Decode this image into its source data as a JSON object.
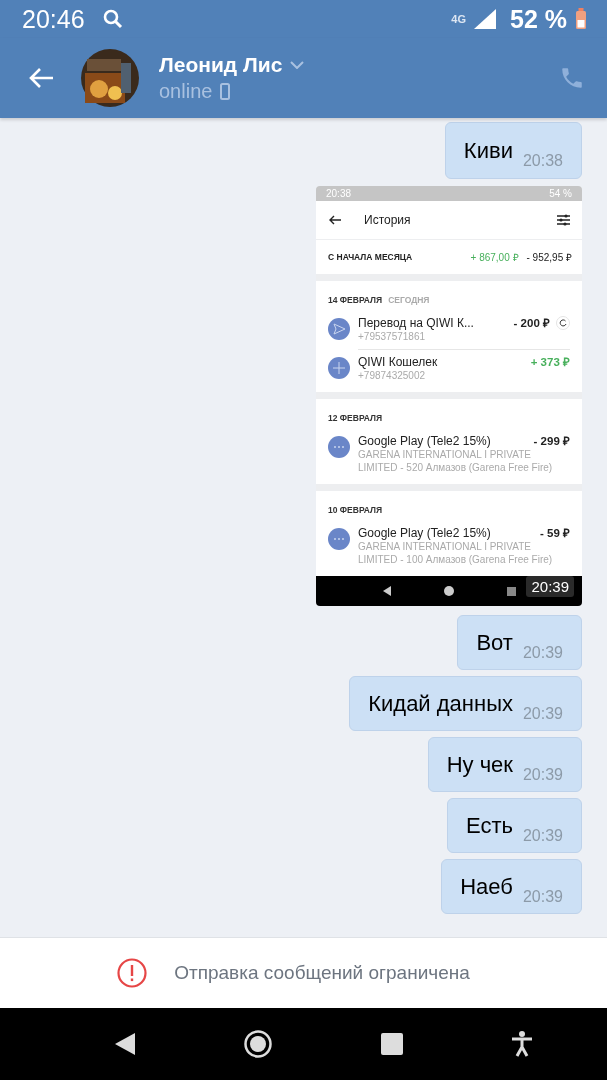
{
  "status_bar": {
    "time": "20:46",
    "network": "4G",
    "battery": "52 %"
  },
  "header": {
    "name": "Леонид Лис",
    "status": "online"
  },
  "messages": [
    {
      "kind": "text",
      "text": "Киви",
      "time": "20:38"
    },
    {
      "kind": "screenshot",
      "time": "20:39",
      "shot": {
        "status_time": "20:38",
        "battery": "54 %",
        "title": "История",
        "summary": {
          "label": "С НАЧАЛА МЕСЯЦА",
          "income": "+ 867,00 ₽",
          "expense": "- 952,95 ₽"
        },
        "groups": [
          {
            "date": "14 ФЕВРАЛЯ",
            "note": "СЕГОДНЯ",
            "items": [
              {
                "kind": "transfer",
                "title": "Перевод на QIWI К...",
                "sub": "+79537571861",
                "amount": "- 200 ₽",
                "positive": false,
                "repeat": true
              },
              {
                "kind": "topup",
                "title": "QIWI Кошелек",
                "sub": "+79874325002",
                "amount": "+ 373 ₽",
                "positive": true,
                "repeat": false
              }
            ]
          },
          {
            "date": "12 ФЕВРАЛЯ",
            "items": [
              {
                "kind": "payment",
                "title": "Google Play (Tele2 15%)",
                "sub": "GARENA INTERNATIONAL I PRIVATE LIMITED - 520 Алмазов (Garena Free Fire)",
                "amount": "- 299 ₽",
                "positive": false,
                "repeat": false
              }
            ]
          },
          {
            "date": "10 ФЕВРАЛЯ",
            "items": [
              {
                "kind": "payment",
                "title": "Google Play (Tele2 15%)",
                "sub": "GARENA INTERNATIONAL I PRIVATE LIMITED - 100 Алмазов (Garena Free Fire)",
                "amount": "- 59 ₽",
                "positive": false,
                "repeat": false
              }
            ]
          }
        ]
      }
    },
    {
      "kind": "text",
      "text": "Вот",
      "time": "20:39"
    },
    {
      "kind": "text",
      "text": "Кидай данных",
      "time": "20:39"
    },
    {
      "kind": "text",
      "text": "Ну чек",
      "time": "20:39"
    },
    {
      "kind": "text",
      "text": "Есть",
      "time": "20:39"
    },
    {
      "kind": "text",
      "text": "Наеб",
      "time": "20:39"
    }
  ],
  "restriction": {
    "text": "Отправка сообщений ограничена"
  }
}
